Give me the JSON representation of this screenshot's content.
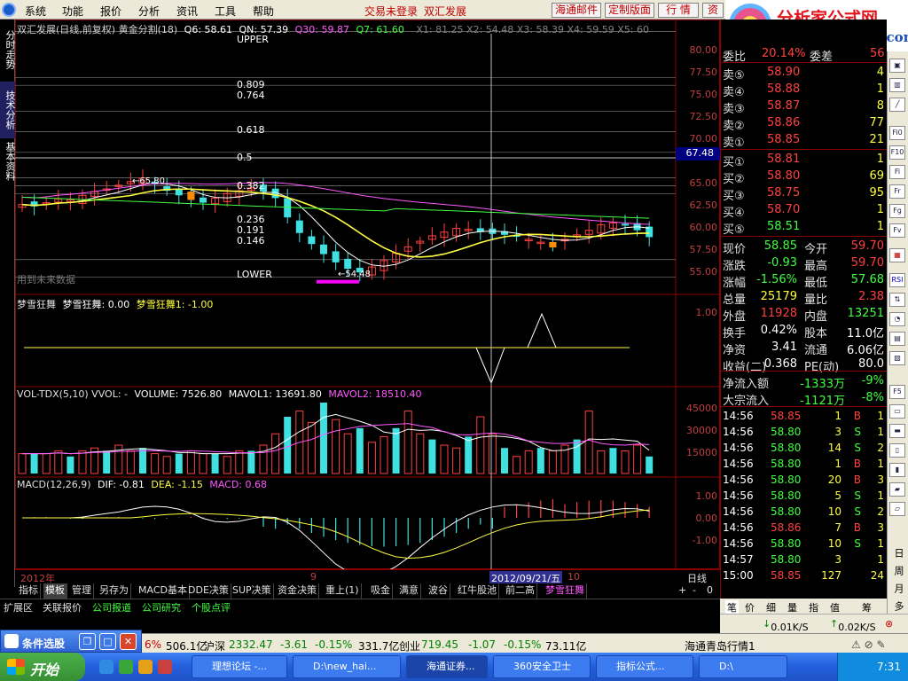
{
  "menu": {
    "items": [
      "系统",
      "功能",
      "报价",
      "分析",
      "资讯",
      "工具",
      "帮助"
    ],
    "trade_status": "交易未登录",
    "account": "双汇发展",
    "buttons": [
      "海通邮件",
      "定制版面",
      "行 情",
      "资"
    ]
  },
  "brand": {
    "title": "分析家公式网",
    "url": "www.88gs.com"
  },
  "left_tabs": [
    "分时走势",
    "技术分析",
    "基本资料"
  ],
  "main_chart": {
    "title": "双汇发展(日线,前复权) 黄金分割(18)",
    "q6": "Q6: 58.61",
    "qn": "QN: 57.39",
    "q30": "Q30: 59.87",
    "q7": "Q7: 61.60",
    "xy": "X1: 81.25 X2: 54.48 X3: 58.39 X4: 59.59 X5: 60",
    "upper": "UPPER",
    "lower": "LOWER",
    "high_label": "65.80",
    "low_label": "54.48",
    "fib": [
      "0.809",
      "0.764",
      "0.618",
      "0.5",
      "0.382",
      "0.236",
      "0.191",
      "0.146"
    ],
    "y_ticks": [
      "80.00",
      "77.50",
      "75.00",
      "72.50",
      "70.00",
      "67.48",
      "65.00",
      "62.50",
      "60.00",
      "57.50",
      "55.00"
    ],
    "watermark": "用到未来数据"
  },
  "osc": {
    "title_prefix": "梦雪狂舞",
    "line1": "梦雪狂舞: 0.00",
    "line2": "梦雪狂舞1: -1.00",
    "y_tick": "1.00"
  },
  "vol": {
    "title": "VOL-TDX(5,10) VVOL: -",
    "volume": "VOLUME: 7526.80",
    "mavol1": "MAVOL1: 13691.80",
    "mavol2": "MAVOL2: 18510.40",
    "y_ticks": [
      "45000",
      "30000",
      "15000"
    ]
  },
  "macd": {
    "title": "MACD(12,26,9)",
    "dif": "DIF: -0.81",
    "dea": "DEA: -1.15",
    "macd": "MACD: 0.68",
    "y_ticks": [
      "1.00",
      "0.00",
      "-1.00"
    ]
  },
  "dates": {
    "year": "2012年",
    "m9": "9",
    "cursor": "2012/09/21/五",
    "m10": "10",
    "period": "日线"
  },
  "bottom_tabs": [
    "指标",
    "模板",
    "管理",
    "另存为",
    "MACD基本",
    "DDE决策",
    "SUP决策",
    "资金决策",
    "重上(1)",
    "吸金",
    "满意",
    "波谷",
    "红牛股池",
    "前二高",
    "梦雪狂舞"
  ],
  "bottom_bar": [
    "扩展区",
    "关联报价",
    "公司报道",
    "公司研究",
    "个股点评"
  ],
  "quote": {
    "wb_label": "委比",
    "wb_value": "20.14%",
    "wc_label": "委差",
    "wc_value": "56",
    "sell": [
      {
        "label": "卖⑤",
        "price": "58.90",
        "vol": "4"
      },
      {
        "label": "卖④",
        "price": "58.88",
        "vol": "1"
      },
      {
        "label": "卖③",
        "price": "58.87",
        "vol": "8"
      },
      {
        "label": "卖②",
        "price": "58.86",
        "vol": "77"
      },
      {
        "label": "卖①",
        "price": "58.85",
        "vol": "21"
      }
    ],
    "buy": [
      {
        "label": "买①",
        "price": "58.81",
        "vol": "1"
      },
      {
        "label": "买②",
        "price": "58.80",
        "vol": "69"
      },
      {
        "label": "买③",
        "price": "58.75",
        "vol": "95"
      },
      {
        "label": "买④",
        "price": "58.70",
        "vol": "1"
      },
      {
        "label": "买⑤",
        "price": "58.51",
        "vol": "1"
      }
    ],
    "stats": [
      {
        "l1": "现价",
        "v1": "58.85",
        "l2": "今开",
        "v2": "59.70"
      },
      {
        "l1": "涨跌",
        "v1": "-0.93",
        "l2": "最高",
        "v2": "59.70"
      },
      {
        "l1": "涨幅",
        "v1": "-1.56%",
        "l2": "最低",
        "v2": "57.68"
      },
      {
        "l1": "总量",
        "v1": "25179",
        "l2": "量比",
        "v2": "2.38"
      },
      {
        "l1": "外盘",
        "v1": "11928",
        "l2": "内盘",
        "v2": "13251"
      },
      {
        "l1": "换手",
        "v1": "0.42%",
        "l2": "股本",
        "v2": "11.0亿"
      },
      {
        "l1": "净资",
        "v1": "3.41",
        "l2": "流通",
        "v2": "6.06亿"
      },
      {
        "l1": "收益(二)",
        "v1": "0.368",
        "l2": "PE(动)",
        "v2": "80.0"
      }
    ],
    "flow": [
      {
        "label": "净流入额",
        "v": "-1333万",
        "p": "-9%"
      },
      {
        "label": "大宗流入",
        "v": "-1121万",
        "p": "-8%"
      }
    ],
    "ticks": [
      {
        "t": "14:56",
        "p": "58.85",
        "v": "1",
        "d": "B",
        "n": "1"
      },
      {
        "t": "14:56",
        "p": "58.80",
        "v": "3",
        "d": "S",
        "n": "1"
      },
      {
        "t": "14:56",
        "p": "58.80",
        "v": "14",
        "d": "S",
        "n": "2"
      },
      {
        "t": "14:56",
        "p": "58.80",
        "v": "1",
        "d": "B",
        "n": "1"
      },
      {
        "t": "14:56",
        "p": "58.80",
        "v": "20",
        "d": "B",
        "n": "3"
      },
      {
        "t": "14:56",
        "p": "58.80",
        "v": "5",
        "d": "S",
        "n": "1"
      },
      {
        "t": "14:56",
        "p": "58.80",
        "v": "10",
        "d": "S",
        "n": "2"
      },
      {
        "t": "14:56",
        "p": "58.86",
        "v": "7",
        "d": "B",
        "n": "3"
      },
      {
        "t": "14:56",
        "p": "58.80",
        "v": "10",
        "d": "S",
        "n": "1"
      },
      {
        "t": "14:57",
        "p": "58.80",
        "v": "3",
        "d": "",
        "n": "1"
      },
      {
        "t": "15:00",
        "p": "58.85",
        "v": "127",
        "d": "",
        "n": "24"
      }
    ],
    "tabs": [
      "笔",
      "价",
      "细",
      "量",
      "指",
      "值",
      "筹"
    ]
  },
  "right_tools": [
    "Fi0",
    "F10",
    "RSI",
    "F5"
  ],
  "right_vertical": [
    "日",
    "周",
    "月",
    "多"
  ],
  "speed": {
    "down": "0.01K/S",
    "up": "0.02K/S"
  },
  "status": {
    "panel_title": "条件选股",
    "items": [
      "6%",
      "506.1亿",
      "沪深",
      "2332.47",
      "-3.61",
      "-0.15%",
      "331.7亿",
      "创业",
      "719.45",
      "-1.07",
      "-0.15%",
      "73.11亿"
    ],
    "right": "海通青岛行情1"
  },
  "taskbar": {
    "start": "开始",
    "tasks": [
      "理想论坛 -...",
      "D:\\new_hai...",
      "海通证券...",
      "360安全卫士",
      "指标公式...",
      "D:\\"
    ],
    "time": "7:31"
  }
}
